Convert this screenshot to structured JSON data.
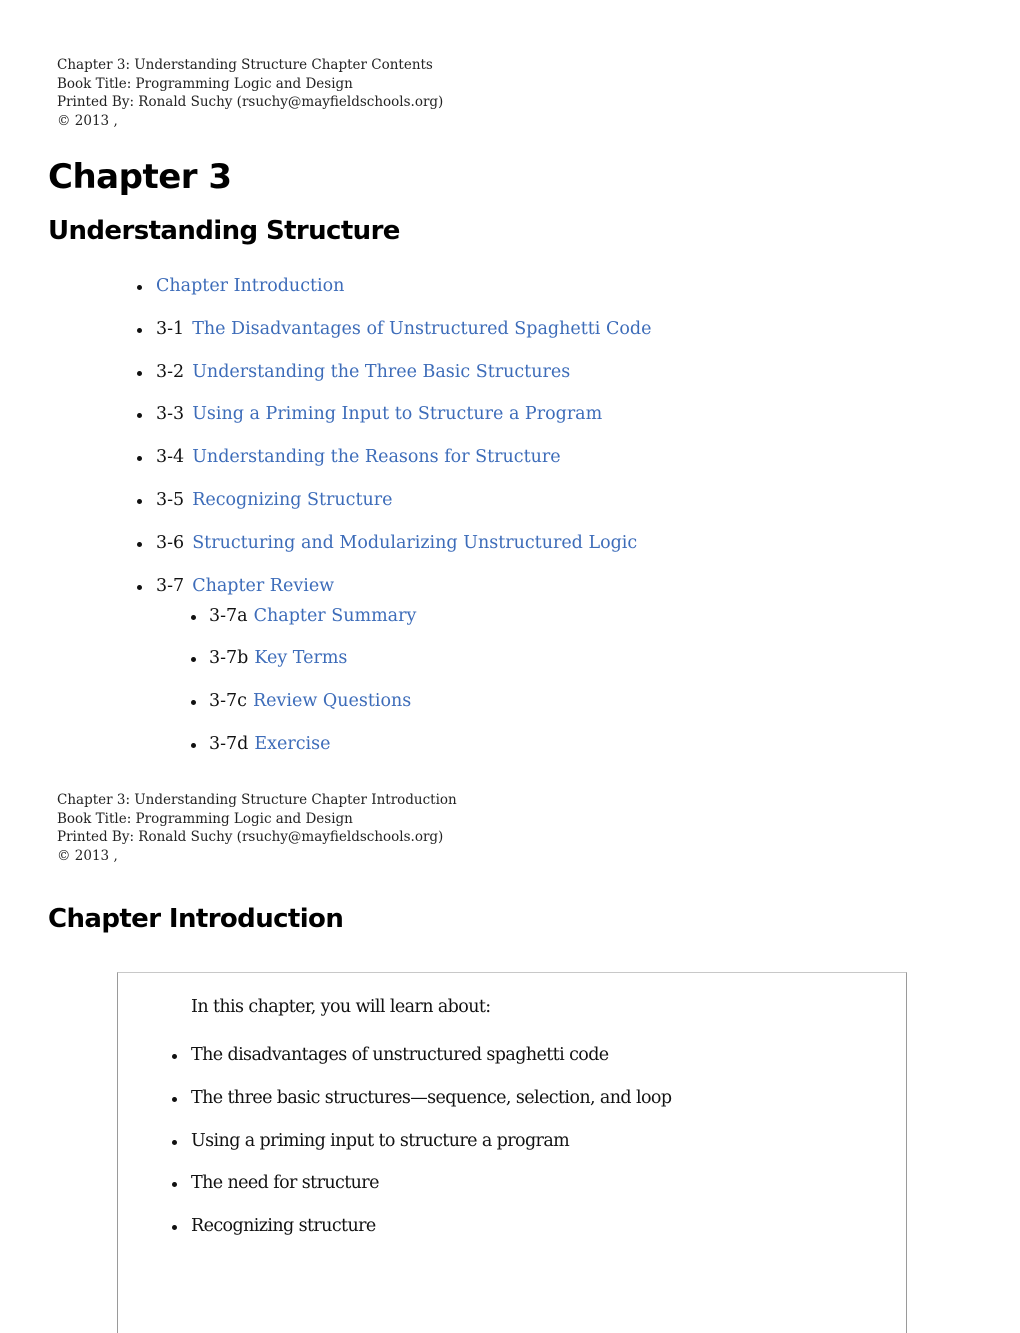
{
  "header_block_1": {
    "line1": "Chapter 3: Understanding Structure Chapter Contents",
    "line2": "Book Title: Programming Logic and Design",
    "line3": "Printed By: Ronald Suchy (rsuchy@mayfieldschools.org)",
    "line4": "© 2013 ,"
  },
  "chapter_title": "Chapter 3",
  "chapter_subtitle": "Understanding Structure",
  "toc": {
    "items": [
      {
        "num": "",
        "label": "Chapter Introduction"
      },
      {
        "num": "3-1",
        "label": "The Disadvantages of Unstructured Spaghetti Code"
      },
      {
        "num": "3-2",
        "label": "Understanding the Three Basic Structures"
      },
      {
        "num": "3-3",
        "label": "Using a Priming Input to Structure a Program"
      },
      {
        "num": "3-4",
        "label": "Understanding the Reasons for Structure"
      },
      {
        "num": "3-5",
        "label": "Recognizing Structure"
      },
      {
        "num": "3-6",
        "label": "Structuring and Modularizing Unstructured Logic"
      },
      {
        "num": "3-7",
        "label": "Chapter Review"
      }
    ],
    "subitems": [
      {
        "num": "3-7a",
        "label": "Chapter Summary"
      },
      {
        "num": "3-7b",
        "label": "Key Terms"
      },
      {
        "num": "3-7c",
        "label": "Review Questions"
      },
      {
        "num": "3-7d",
        "label": "Exercise"
      }
    ]
  },
  "header_block_2": {
    "line1": "Chapter 3: Understanding Structure Chapter Introduction",
    "line2": "Book Title: Programming Logic and Design",
    "line3": "Printed By: Ronald Suchy (rsuchy@mayfieldschools.org)",
    "line4": "© 2013 ,"
  },
  "section_title": "Chapter Introduction",
  "objectives": {
    "intro": "In this chapter, you will learn about:",
    "items": [
      "The disadvantages of unstructured spaghetti code",
      "The three basic structures—sequence, selection, and loop",
      "Using a priming input to structure a program",
      "The need for structure",
      "Recognizing structure"
    ]
  },
  "colors": {
    "link": "#3d6cb9",
    "text": "#111111",
    "box_border": "#9a9a9a"
  }
}
